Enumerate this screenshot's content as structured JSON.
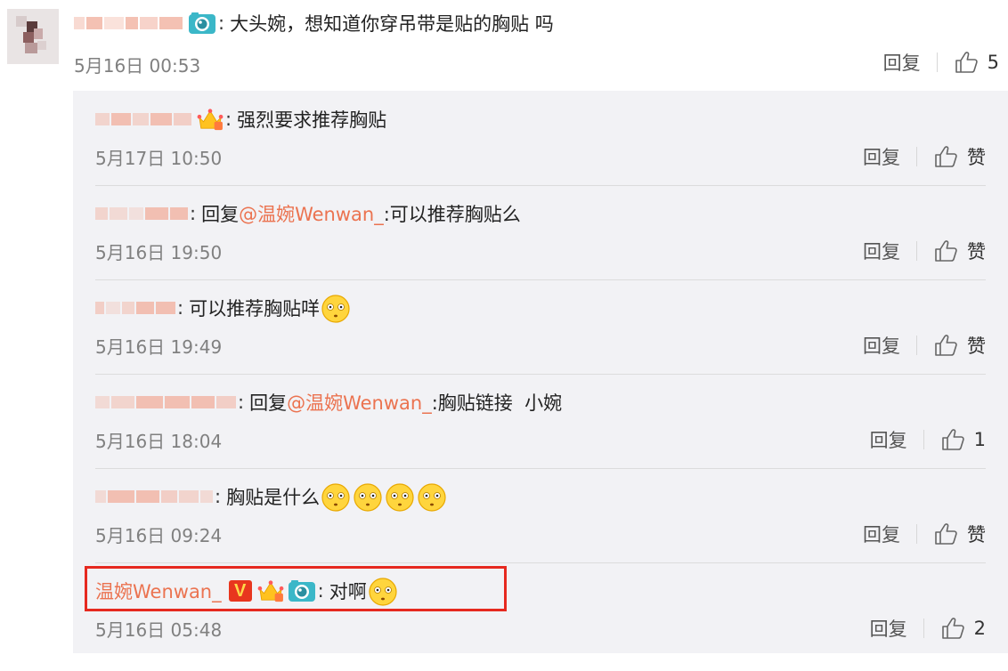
{
  "top_comment": {
    "text": "大头婉，想知道你穿吊带是贴的胸贴 吗",
    "time": "5月16日 00:53",
    "reply_label": "回复",
    "like_count": "5"
  },
  "replies": [
    {
      "text": "强烈要求推荐胸贴",
      "time": "5月17日 10:50",
      "reply_label": "回复",
      "like_label": "赞"
    },
    {
      "prefix": "回复",
      "mention": "@温婉Wenwan_",
      "text": ":可以推荐胸贴么",
      "time": "5月16日 19:50",
      "reply_label": "回复",
      "like_label": "赞"
    },
    {
      "text": "可以推荐胸贴咩",
      "time": "5月16日 19:49",
      "reply_label": "回复",
      "like_label": "赞"
    },
    {
      "prefix": "回复",
      "mention": "@温婉Wenwan_",
      "text": ":胸贴链接  小婉",
      "time": "5月16日 18:04",
      "reply_label": "回复",
      "like_label": "1"
    },
    {
      "text": "胸贴是什么",
      "time": "5月16日 09:24",
      "reply_label": "回复",
      "like_label": "赞"
    },
    {
      "username": "温婉Wenwan_",
      "text": "对啊",
      "time": "5月16日 05:48",
      "reply_label": "回复",
      "like_label": "2"
    }
  ],
  "colors": {
    "accent": "#eb7350",
    "highlight": "#e6291f",
    "panel": "#f2f2f5"
  },
  "icons": [
    "camera-icon",
    "crown-vip-icon",
    "verified-v-icon",
    "thumbs-up-icon",
    "emoji-hands-covering-face",
    "emoji-question-face",
    "emoji-peeking-face"
  ]
}
